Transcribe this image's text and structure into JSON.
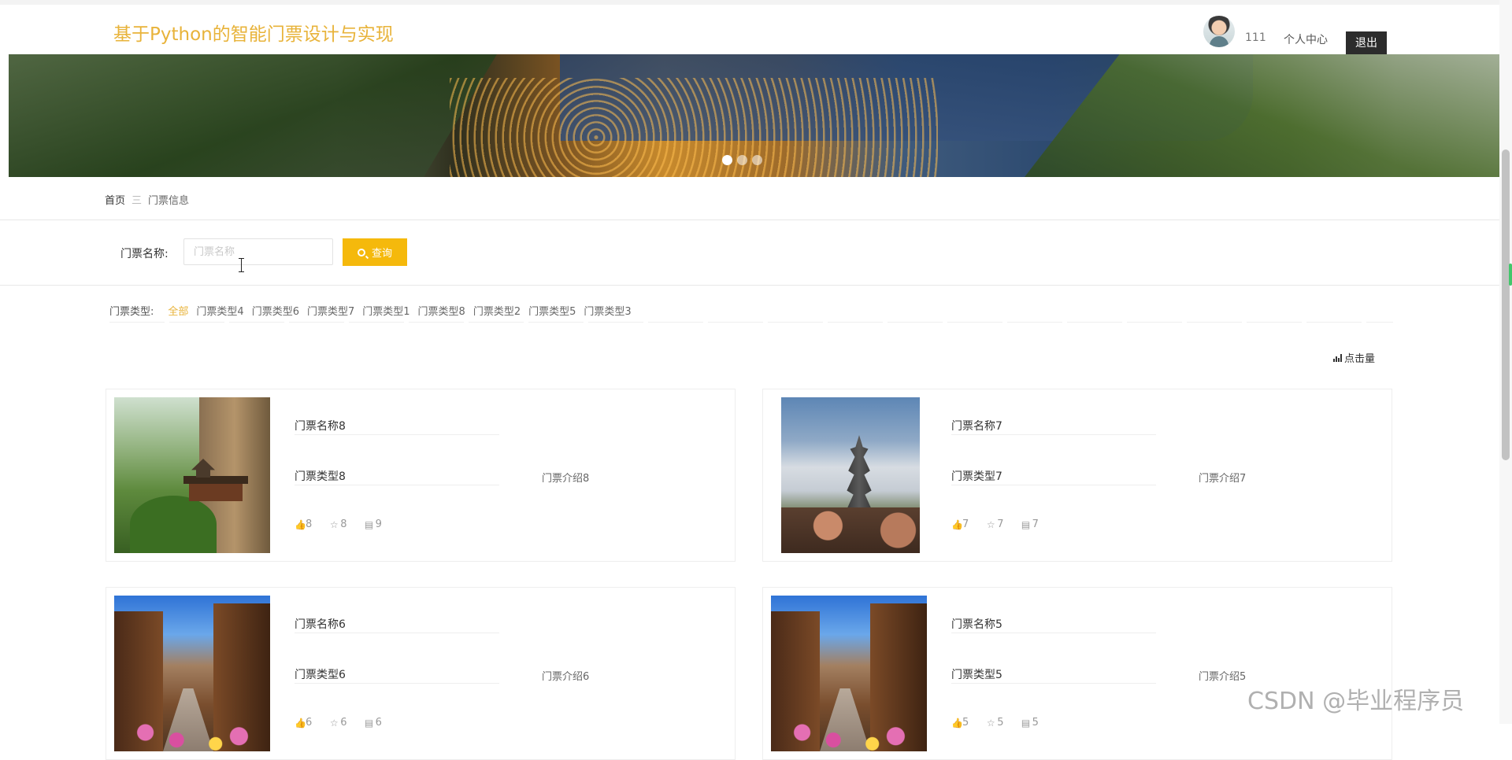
{
  "header": {
    "site_title": "基于Python的智能门票设计与实现",
    "username": "111",
    "personal_center": "个人中心",
    "logout": "退出"
  },
  "breadcrumb": {
    "home": "首页",
    "separator": "三",
    "current": "门票信息"
  },
  "search": {
    "label": "门票名称:",
    "placeholder": "门票名称",
    "button": "查询"
  },
  "filter": {
    "label": "门票类型:",
    "types": [
      "全部",
      "门票类型4",
      "门票类型6",
      "门票类型7",
      "门票类型1",
      "门票类型8",
      "门票类型2",
      "门票类型5",
      "门票类型3"
    ],
    "active": "全部"
  },
  "sort": {
    "label": "点击量"
  },
  "cards": [
    {
      "name": "门票名称8",
      "type": "门票类型8",
      "intro": "门票介绍8",
      "likes": "8",
      "favorites": "8",
      "views": "9",
      "image": "mountain"
    },
    {
      "name": "门票名称7",
      "type": "门票类型7",
      "intro": "门票介绍7",
      "likes": "7",
      "favorites": "7",
      "views": "7",
      "image": "pagoda"
    },
    {
      "name": "门票名称6",
      "type": "门票类型6",
      "intro": "门票介绍6",
      "likes": "6",
      "favorites": "6",
      "views": "6",
      "image": "street"
    },
    {
      "name": "门票名称5",
      "type": "门票类型5",
      "intro": "门票介绍5",
      "likes": "5",
      "favorites": "5",
      "views": "5",
      "image": "street"
    }
  ],
  "carousel": {
    "active_index": 0
  },
  "watermark": "CSDN @毕业程序员",
  "colors": {
    "accent": "#e8b33a",
    "button": "#f5b90c",
    "logout_bg": "#2c2c2c"
  }
}
